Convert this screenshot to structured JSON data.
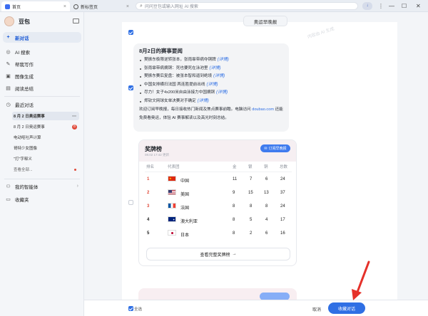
{
  "titlebar": {
    "tabs": [
      {
        "label": "首页",
        "active": true
      },
      {
        "label": "新标签页",
        "active": false
      }
    ],
    "address_placeholder": "问问豆包或输入网址 AI 搜索",
    "window_controls": {
      "minimize": "—",
      "maximize": "☐",
      "close": "✕"
    }
  },
  "sidebar": {
    "brand": "豆包",
    "new_chat": "新对话",
    "items": [
      {
        "icon": "ai-search-icon",
        "label": "AI 搜索"
      },
      {
        "icon": "writing-icon",
        "label": "帮我写作"
      },
      {
        "icon": "image-icon",
        "label": "图像生成"
      },
      {
        "icon": "reading-icon",
        "label": "阅读总结"
      }
    ],
    "recent_title": "最近对话",
    "recent": [
      {
        "label": "8 月 2 日奥运赛事",
        "active": true,
        "more": "⋯"
      },
      {
        "label": "8 月 2 日奥运赛事",
        "badge": "8"
      },
      {
        "label": "电动呕吐声计算"
      },
      {
        "label": "哥特少女图像"
      },
      {
        "label": "\"打\"字释义"
      },
      {
        "label": "查看全部...",
        "dot": true
      }
    ],
    "agents": "我的智能体",
    "favorites": "收藏夹"
  },
  "toolbar": {
    "quick_reply": "奥运早晚报"
  },
  "watermark": "内容由 AI 生成",
  "answer": {
    "title": "8月2日的赛事要闻",
    "bullets": [
      "樊振东极限逆转张本，张雨霏带病夺铜牌",
      "张雨霏带病摘铜：死也要死在泳池里",
      "樊振东赛后复盘：被张本智和逼到绝境",
      "中国女排横扫法国 两连胜提前出线",
      "尽力！女子4x200米自由泳接力中国摘铜",
      "郑钦文网球女单决赛对手确定"
    ],
    "more_label": "(详情)",
    "intro_a": "欢迎订阅早晚报，每日接收热门新闻及焦点赛事前瞻。电脑访问",
    "intro_link": "doubao.com",
    "intro_b": "还能免费看奥运，体验 AI 赛事解读以及高光时刻总结。"
  },
  "medal_table": {
    "title": "奖牌榜",
    "updated": "08.02 17:42 更新",
    "subscribe": "订阅早晚报",
    "headers": [
      "排名",
      "代表团",
      "金",
      "银",
      "铜",
      "总数"
    ],
    "rows": [
      {
        "rank": "1",
        "team": "中国",
        "gold": "11",
        "silver": "7",
        "bronze": "6",
        "total": "24",
        "rank_color": "#e04a3a"
      },
      {
        "rank": "2",
        "team": "美国",
        "gold": "9",
        "silver": "15",
        "bronze": "13",
        "total": "37",
        "rank_color": "#e04a3a"
      },
      {
        "rank": "3",
        "team": "法国",
        "gold": "8",
        "silver": "8",
        "bronze": "8",
        "total": "24",
        "rank_color": "#e04a3a"
      },
      {
        "rank": "4",
        "team": "澳大利亚",
        "gold": "8",
        "silver": "5",
        "bronze": "4",
        "total": "17",
        "rank_color": "#222222"
      },
      {
        "rank": "5",
        "team": "日本",
        "gold": "8",
        "silver": "2",
        "bronze": "6",
        "total": "16",
        "rank_color": "#222222"
      }
    ],
    "view_all": "查看完整奖牌榜",
    "view_all_arrow": "→"
  },
  "bottombar": {
    "select_all": "全选",
    "cancel": "取消",
    "collect": "收藏对话"
  },
  "colors": {
    "accent": "#2f6fe4",
    "red": "#e04a3a",
    "arrow": "#e5312a"
  }
}
